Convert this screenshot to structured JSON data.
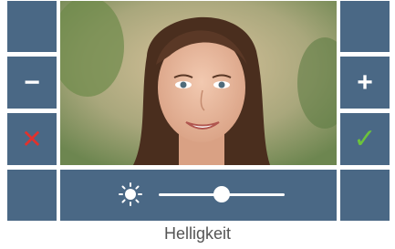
{
  "controls": {
    "minus_symbol": "−",
    "plus_symbol": "+",
    "cancel_symbol": "✕",
    "confirm_symbol": "✓"
  },
  "brightness": {
    "label": "Helligkeit",
    "level_fraction": 0.5,
    "icon": "sun-icon"
  },
  "colors": {
    "button_bg": "#4a6885",
    "cancel": "#e0322d",
    "confirm": "#6cc33c"
  },
  "video": {
    "content": "live-video-feed"
  }
}
